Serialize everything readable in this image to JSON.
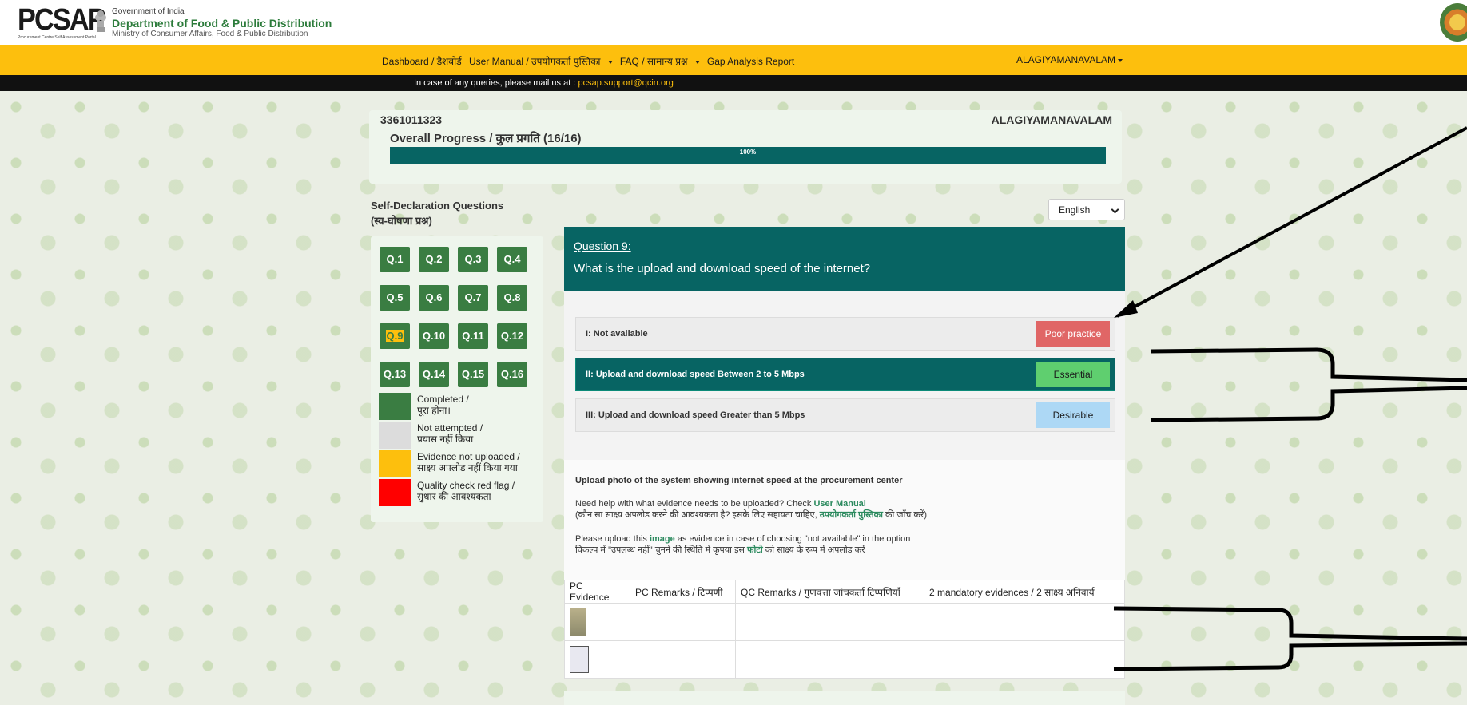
{
  "header": {
    "logo_text": "PCSAP",
    "logo_subtext": "Procurement Centre Self Assessment Portal",
    "gov_line1": "Government of India",
    "gov_line2": "Department of Food & Public Distribution",
    "gov_line3": "Ministry of Consumer Affairs, Food & Public Distribution"
  },
  "nav": {
    "items": [
      {
        "label": "Dashboard / डैशबोर्ड",
        "dropdown": false
      },
      {
        "label": "User Manual / उपयोगकर्ता पुस्तिका",
        "dropdown": true
      },
      {
        "label": "FAQ / सामान्य प्रश्न",
        "dropdown": true
      },
      {
        "label": "Gap Analysis Report",
        "dropdown": false
      }
    ],
    "user": "ALAGIYAMANAVALAM"
  },
  "info": {
    "text": "In case of any queries, please mail us at : ",
    "email": "pcsap.support@qcin.org"
  },
  "progress": {
    "center_code": "3361011323",
    "center_name": "ALAGIYAMANAVALAM",
    "title": "Overall Progress / कुल प्रगति (16/16)",
    "percent_label": "100%",
    "fraction": 1.0
  },
  "sidebar": {
    "heading_line1": "Self-Declaration Questions",
    "heading_line2": "(स्व-घोषणा प्रश्न)",
    "questions": [
      "Q.1",
      "Q.2",
      "Q.3",
      "Q.4",
      "Q.5",
      "Q.6",
      "Q.7",
      "Q.8",
      "Q.9",
      "Q.10",
      "Q.11",
      "Q.12",
      "Q.13",
      "Q.14",
      "Q.15",
      "Q.16"
    ],
    "current": "Q.9",
    "legend": [
      {
        "label_en": "Completed /",
        "label_hi": "पूरा होना।",
        "color": "#3a7d42"
      },
      {
        "label_en": "Not attempted /",
        "label_hi": "प्रयास नहीं किया",
        "color": "#dcdcdc"
      },
      {
        "label_en": "Evidence not uploaded /",
        "label_hi": "साक्ष्य अपलोड नहीं किया गया",
        "color": "#fdbf0d"
      },
      {
        "label_en": "Quality check red flag /",
        "label_hi": "सुधार की आवश्यकता",
        "color": "#ff0000"
      }
    ]
  },
  "language": {
    "selected": "English"
  },
  "question": {
    "number": "Question 9:",
    "text": "What is the upload and download speed of the internet?",
    "options": [
      {
        "label": "I: Not available",
        "badge": "Poor practice",
        "badge_color": "#e06666",
        "badge_text_color": "#ffffff",
        "selected": false
      },
      {
        "label": "II: Upload and download speed Between 2 to 5 Mbps",
        "badge": "Essential",
        "badge_color": "#5fcf6f",
        "badge_text_color": "#1a1a1a",
        "selected": true
      },
      {
        "label": "III: Upload and download speed Greater than 5 Mbps",
        "badge": "Desirable",
        "badge_color": "#add8f5",
        "badge_text_color": "#1a1a1a",
        "selected": false
      }
    ]
  },
  "evidence": {
    "instruction": "Upload photo of the system showing internet speed at the procurement center",
    "help_prefix": "Need help with what evidence needs to be uploaded? Check ",
    "help_link": "User Manual",
    "help_hi_prefix": "(कौन सा साक्ष्य अपलोड करने की आवश्यकता है? इसके लिए सहायता चाहिए, ",
    "help_hi_link": "उपयोगकर्ता पुस्तिका",
    "help_hi_suffix": " की जाँच करें)",
    "upload_prefix": "Please upload this ",
    "upload_link": "image",
    "upload_suffix": " as evidence in case of choosing \"not available\" in the option",
    "upload_hi_prefix": "विकल्प में \"उपलब्ध नहीं\" चुनने की स्थिति में कृपया इस ",
    "upload_hi_link": "फोटो",
    "upload_hi_suffix": " को साक्ष्य के रूप में अपलोड करें"
  },
  "table": {
    "headers": [
      "PC Evidence",
      "PC Remarks / टिप्पणी",
      "QC Remarks / गुणवत्ता जांचकर्ता टिप्पणियाँ",
      "2 mandatory evidences / 2 साक्ष्य अनिवार्य"
    ],
    "rows": [
      {
        "remarks": "",
        "qc": "",
        "extra": ""
      },
      {
        "remarks": "",
        "qc": "",
        "extra": ""
      }
    ]
  }
}
